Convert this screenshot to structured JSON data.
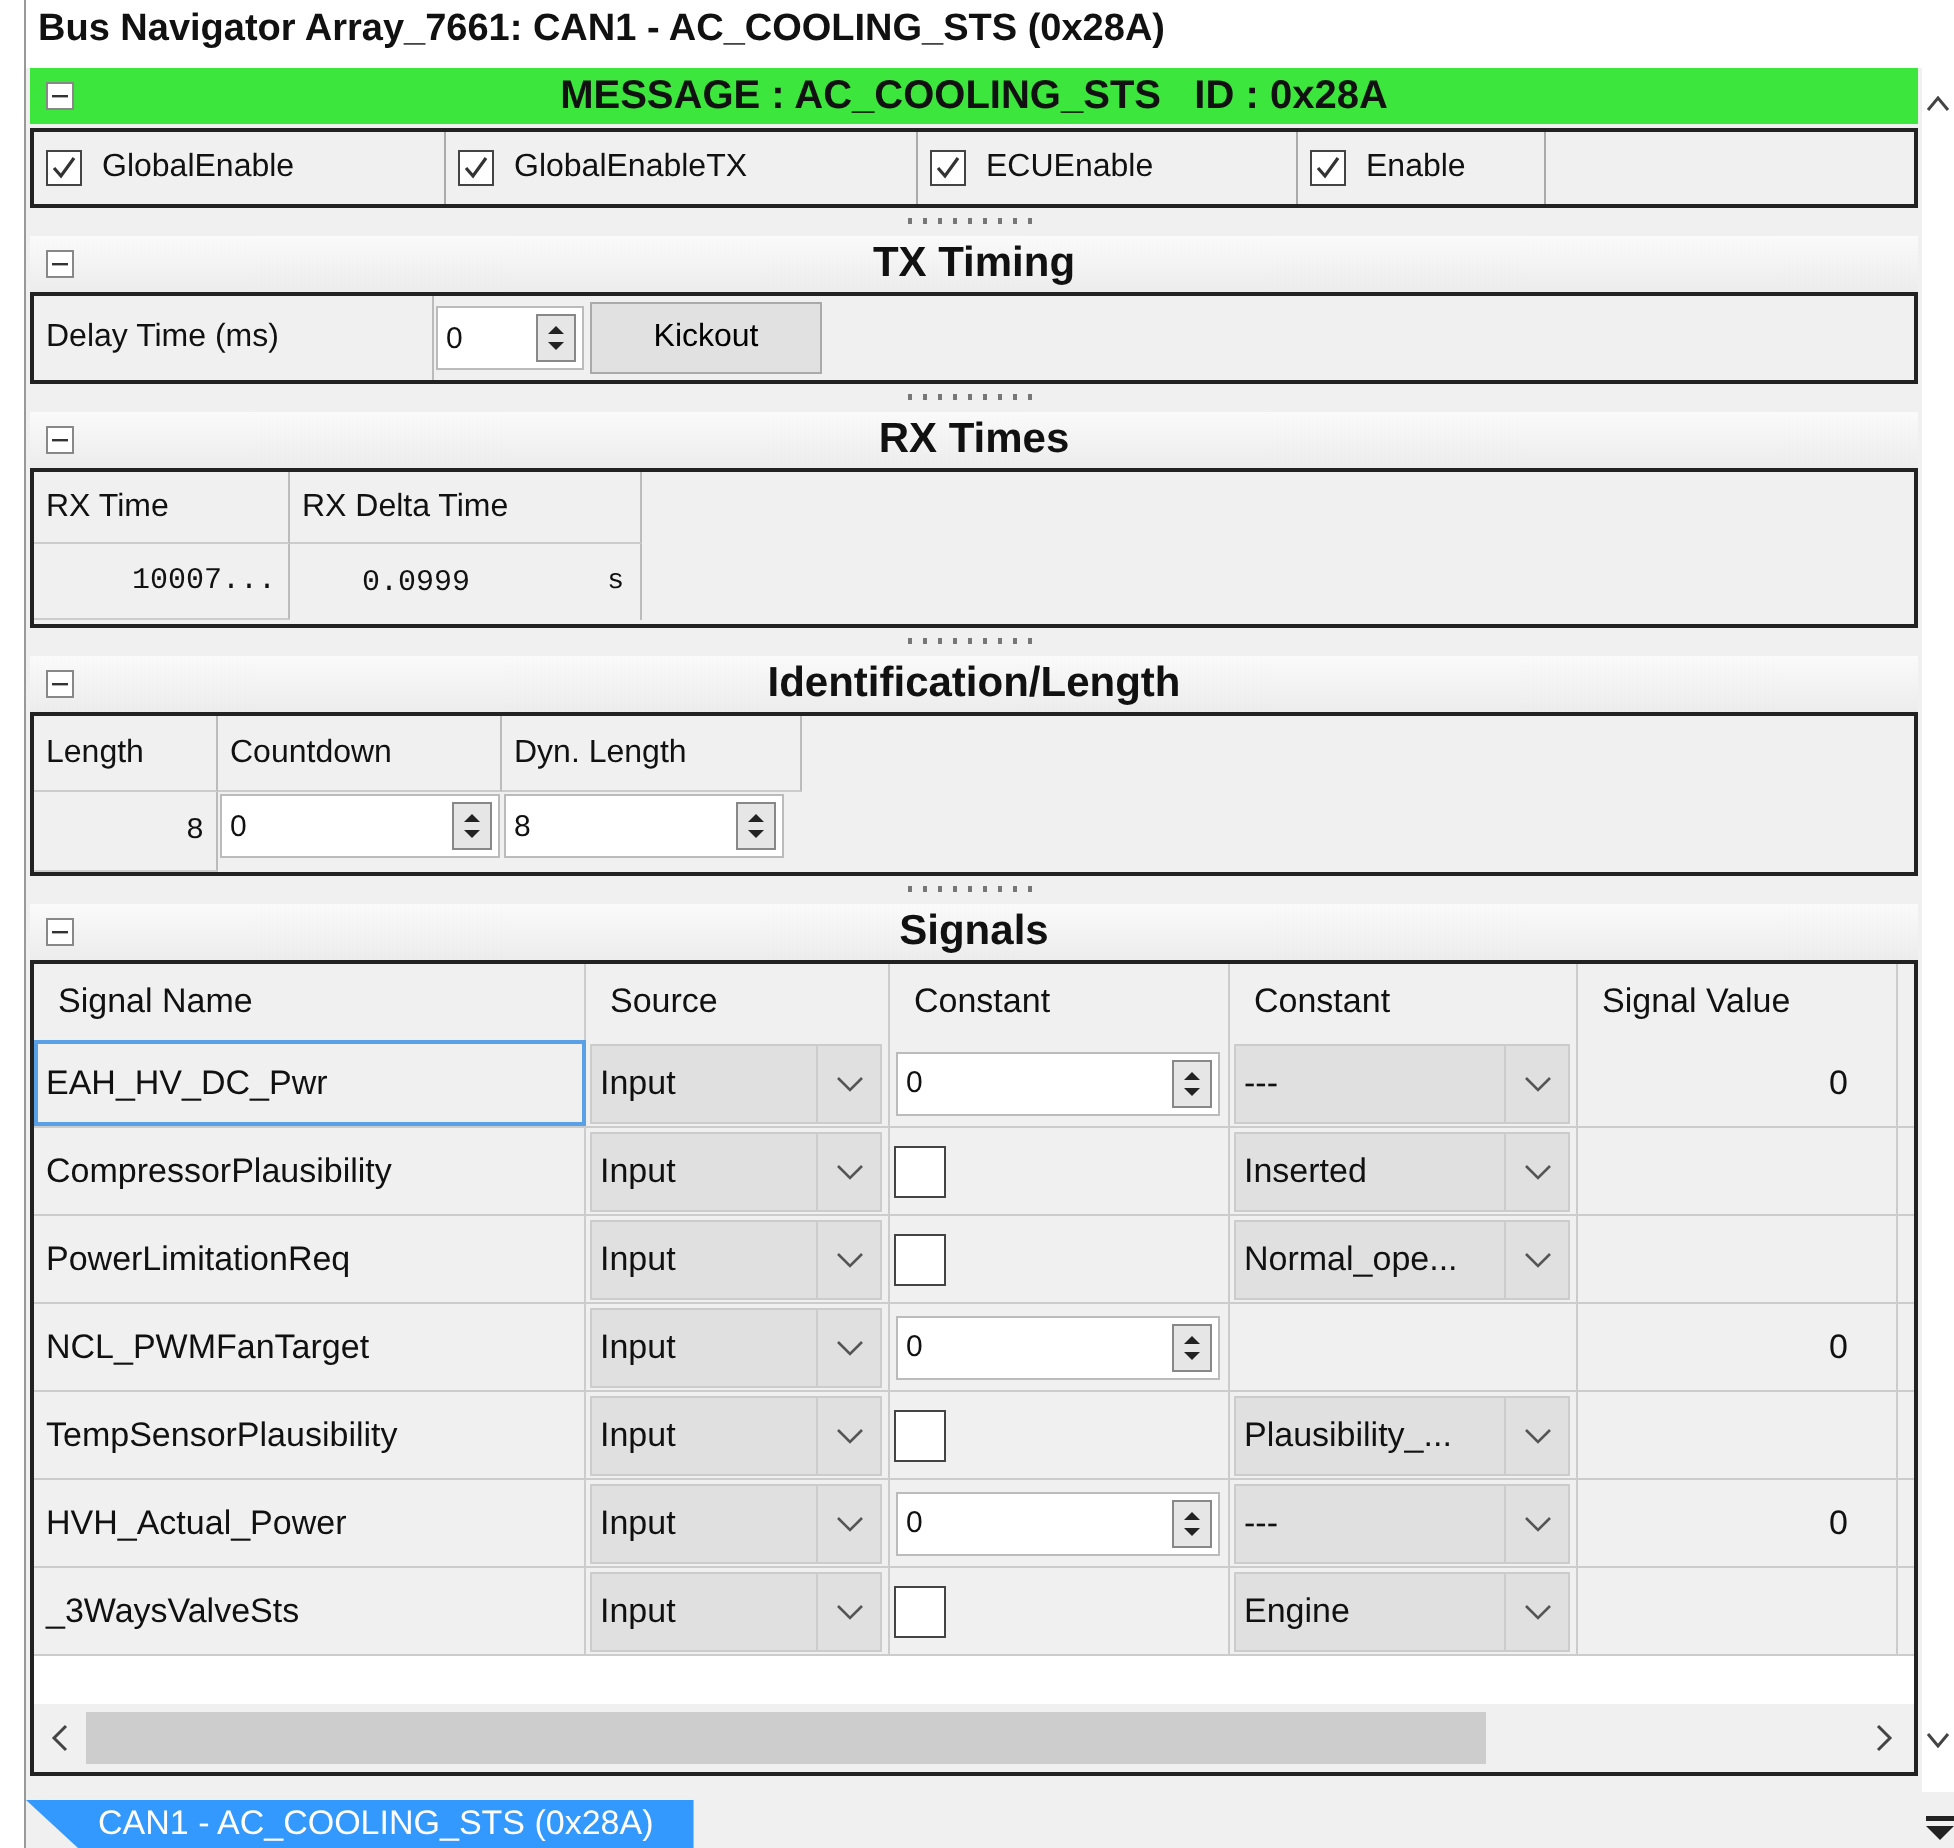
{
  "window": {
    "title": "Bus Navigator Array_7661: CAN1 - AC_COOLING_STS (0x28A)"
  },
  "message_header": "MESSAGE : AC_COOLING_STS   ID : 0x28A",
  "enables": [
    {
      "label": "GlobalEnable",
      "checked": true
    },
    {
      "label": "GlobalEnableTX",
      "checked": true
    },
    {
      "label": "ECUEnable",
      "checked": true
    },
    {
      "label": "Enable",
      "checked": true
    }
  ],
  "tx_timing": {
    "title": "TX Timing",
    "delay_label": "Delay Time (ms)",
    "delay_value": "0",
    "kickout": "Kickout"
  },
  "rx_times": {
    "title": "RX Times",
    "columns": [
      "RX Time",
      "RX Delta Time"
    ],
    "rx_time": "10007...",
    "rx_delta": "0.0999",
    "unit": "s"
  },
  "identification": {
    "title": "Identification/Length",
    "columns": [
      "Length",
      "Countdown",
      "Dyn. Length"
    ],
    "length": "8",
    "countdown": "0",
    "dyn_length": "8"
  },
  "signals": {
    "title": "Signals",
    "columns": [
      "Signal Name",
      "Source",
      "Constant",
      "Constant",
      "Signal Value"
    ],
    "rows": [
      {
        "name": "EAH_HV_DC_Pwr",
        "selected": true,
        "source": "Input",
        "constant": {
          "kind": "spin",
          "value": "0"
        },
        "choice": "---",
        "value": "0"
      },
      {
        "name": "CompressorPlausibility",
        "selected": false,
        "source": "Input",
        "constant": {
          "kind": "check",
          "checked": false
        },
        "choice": "Inserted"
      },
      {
        "name": "PowerLimitationReq",
        "selected": false,
        "source": "Input",
        "constant": {
          "kind": "check",
          "checked": false
        },
        "choice": "Normal_ope..."
      },
      {
        "name": "NCL_PWMFanTarget",
        "selected": false,
        "source": "Input",
        "constant": {
          "kind": "spin",
          "value": "0"
        },
        "value": "0"
      },
      {
        "name": "TempSensorPlausibility",
        "selected": false,
        "source": "Input",
        "constant": {
          "kind": "check",
          "checked": false
        },
        "choice": "Plausibility_..."
      },
      {
        "name": "HVH_Actual_Power",
        "selected": false,
        "source": "Input",
        "constant": {
          "kind": "spin",
          "value": "0"
        },
        "choice": "---",
        "value": "0"
      },
      {
        "name": "_3WaysValveSts",
        "selected": false,
        "source": "Input",
        "constant": {
          "kind": "check",
          "checked": false
        },
        "choice": "Engine"
      }
    ]
  },
  "bottom_tab": {
    "label": "CAN1 - AC_COOLING_STS (0x28A)",
    "selected": true
  }
}
